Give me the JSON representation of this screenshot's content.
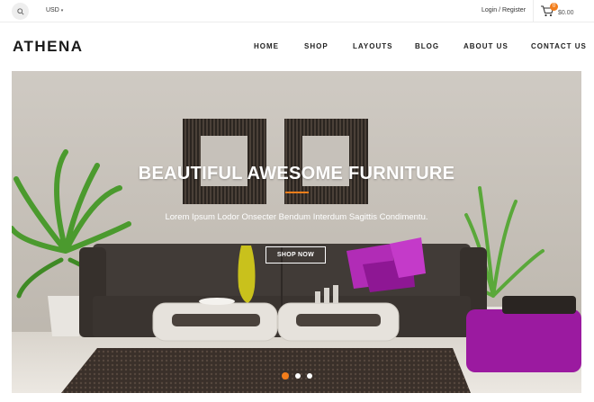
{
  "topbar": {
    "search_icon": "search-icon",
    "currency": "USD",
    "currency_icon": "chevron-down-icon",
    "login_register": "Login / Register",
    "cart_icon": "cart-icon",
    "cart_count": "0",
    "cart_total": "$0.00"
  },
  "header": {
    "logo": "ATHENA",
    "nav": [
      "HOME",
      "SHOP",
      "LAYOUTS",
      "BLOG",
      "ABOUT US",
      "CONTACT US"
    ]
  },
  "hero": {
    "title": "BEAUTIFUL AWESOME FURNITURE",
    "subtitle": "Lorem Ipsum Lodor Onsecter Bendum Interdum Sagittis Condimentu.",
    "button": "SHOP NOW",
    "slides_total": 3,
    "active_slide": 1
  },
  "colors": {
    "accent": "#f37e1b",
    "text_dark": "#222222",
    "sofa": "#3d3835",
    "cushion_purple": "#a31fa8",
    "wall": "#c9c4bd"
  }
}
